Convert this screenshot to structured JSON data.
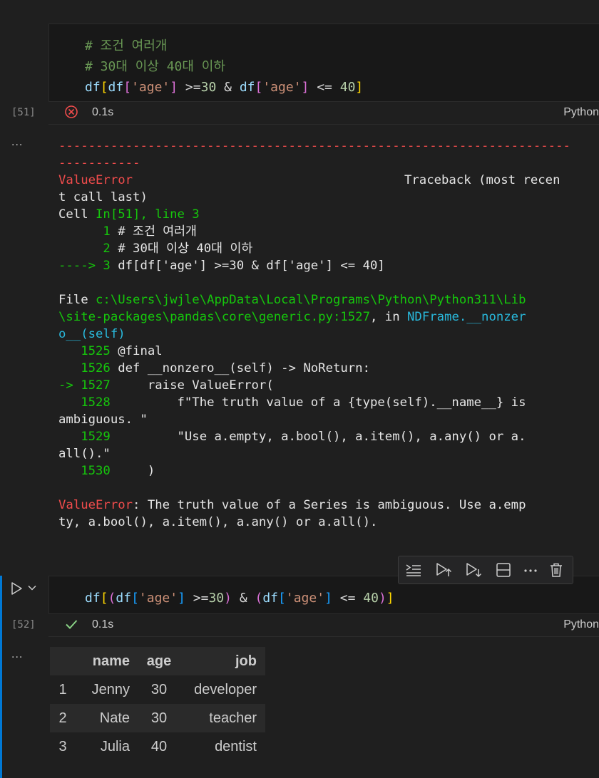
{
  "cell51": {
    "code_lines": [
      "# 조건 여러개",
      "# 30대 이상 40대 이하"
    ],
    "code_line3": {
      "df": "df",
      "open1": "[",
      "df2": "df",
      "open2": "[",
      "key1": "'age'",
      "close2": "]",
      "op1": " >=",
      "n30": "30",
      "amp": " & ",
      "df3": "df",
      "open3": "[",
      "key2": "'age'",
      "close3": "]",
      "op2": " <= ",
      "n40": "40",
      "close1": "]"
    },
    "execution_count": "[51]",
    "status": "error",
    "time": "0.1s",
    "language": "Python"
  },
  "output51": {
    "more_label": "...",
    "dashes1": "---------------------------------------------------------------------",
    "dashes2": "-----------",
    "error_name": "ValueError",
    "traceback_label": "Traceback (most recen",
    "traceback_cont": "t call last)",
    "cell_prefix": "Cell ",
    "cell_ref": "In[51], line 3",
    "src_lines": [
      {
        "num": "      1",
        "code": " # 조건 여러개"
      },
      {
        "num": "      2",
        "code": " # 30대 이상 40대 이하"
      }
    ],
    "arrow_line": {
      "arrow": "----> 3",
      "code": " df[df['age'] >=30 & df['age'] <= 40]"
    },
    "file_prefix": "File ",
    "file_path_1": "c:\\Users\\jwjle\\AppData\\Local\\Programs\\Python\\Python311\\Lib",
    "file_path_2": "\\site-packages\\pandas\\core\\generic.py:1527",
    "file_in": ", in ",
    "file_func": "NDFrame.__nonzer",
    "file_func_2": "o__(self)",
    "lib_lines": [
      {
        "num": "   1525",
        "code": " @final"
      },
      {
        "num": "   1526",
        "code": " def __nonzero__(self) -> NoReturn:"
      }
    ],
    "lib_arrow": {
      "arrow": "-> 1527",
      "code": "     raise ValueError("
    },
    "lib_lines2": [
      {
        "num": "   1528",
        "code": "         f\"The truth value of a {type(self).__name__} is"
      }
    ],
    "wrap1": "ambiguous. \"",
    "lib_lines3": [
      {
        "num": "   1529",
        "code": "         \"Use a.empty, a.bool(), a.item(), a.any() or a."
      }
    ],
    "wrap2": "all().\"",
    "lib_lines4": [
      {
        "num": "   1530",
        "code": "     )"
      }
    ],
    "final_error_name": "ValueError",
    "final_msg_1": ": The truth value of a Series is ambiguous. Use a.emp",
    "final_msg_2": "ty, a.bool(), a.item(), a.any() or a.all()."
  },
  "toolbar": {
    "icons": [
      "run-by-line-icon",
      "run-above-icon",
      "run-below-icon",
      "split-cell-icon",
      "more-actions-icon",
      "delete-icon"
    ]
  },
  "cell52": {
    "code_line": {
      "df": "df",
      "open1": "[",
      "paren1": "(",
      "df2": "df",
      "open2": "[",
      "key1": "'age'",
      "close2": "]",
      "op1": " >=",
      "n30": "30",
      "paren1c": ")",
      "amp": " & ",
      "paren2": "(",
      "df3": "df",
      "open3": "[",
      "key2": "'age'",
      "close3": "]",
      "op2": " <= ",
      "n40": "40",
      "paren2c": ")",
      "close1": "]"
    },
    "execution_count": "[52]",
    "status": "success",
    "time": "0.1s",
    "language": "Python"
  },
  "output52": {
    "more_label": "...",
    "columns": [
      "",
      "name",
      "age",
      "job"
    ],
    "rows": [
      [
        "1",
        "Jenny",
        "30",
        "developer"
      ],
      [
        "2",
        "Nate",
        "30",
        "teacher"
      ],
      [
        "3",
        "Julia",
        "40",
        "dentist"
      ]
    ]
  },
  "colors": {
    "background": "#1f1f1f",
    "error_red": "#f14c4c",
    "success_green": "#89d185",
    "focus_blue": "#0078d4"
  }
}
